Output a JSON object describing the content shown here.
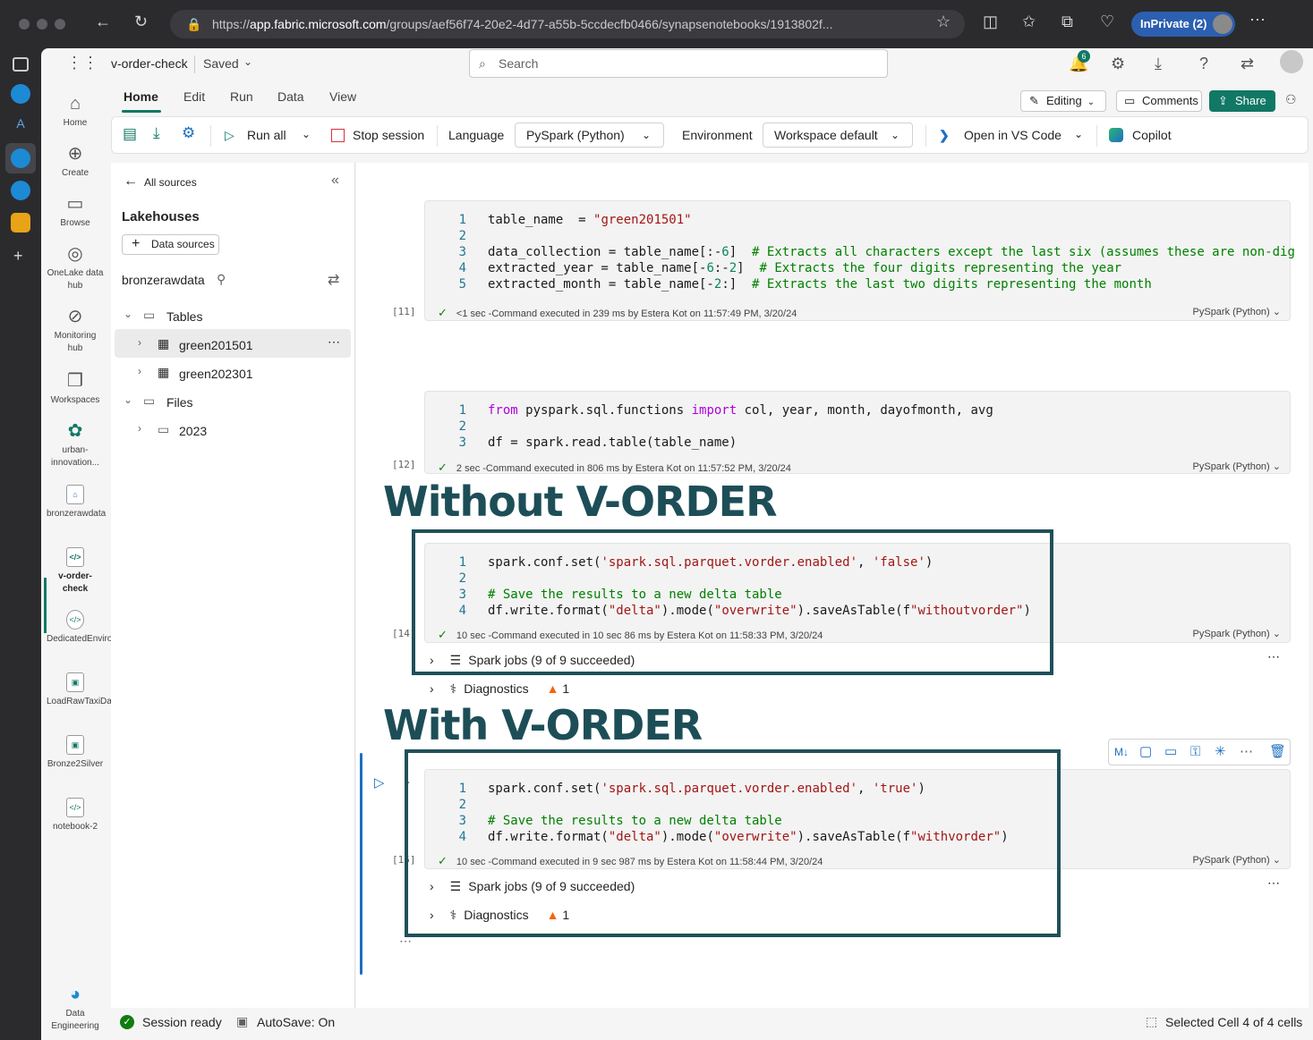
{
  "browser": {
    "url_prefix": "https://",
    "url_domain": "app.fabric.microsoft.com",
    "url_rest": "/groups/aef56f74-20e2-4d77-a55b-5ccdecfb0466/synapsenotebooks/1913802f...",
    "inprivate_label": "InPrivate (2)"
  },
  "header": {
    "notebook_name": "v-order-check",
    "save_state": "Saved",
    "search_placeholder": "Search",
    "notification_count": "6"
  },
  "leftnav": [
    {
      "label": "Home",
      "icon": "home-icon"
    },
    {
      "label": "Create",
      "icon": "create-icon"
    },
    {
      "label": "Browse",
      "icon": "browse-icon"
    },
    {
      "label": "OneLake data hub",
      "icon": "onelake-icon"
    },
    {
      "label": "Monitoring hub",
      "icon": "monitoring-icon"
    },
    {
      "label": "Workspaces",
      "icon": "workspaces-icon"
    },
    {
      "label": "urban-innovation...",
      "icon": "workspace-icon"
    },
    {
      "label": "bronzerawdata",
      "icon": "lakehouse-icon"
    },
    {
      "label": "v-order-check",
      "icon": "notebook-icon"
    },
    {
      "label": "DedicatedEnvironment...",
      "icon": "notebook-icon"
    },
    {
      "label": "LoadRawTaxiData",
      "icon": "pipeline-icon"
    },
    {
      "label": "Bronze2Silver",
      "icon": "pipeline-icon"
    },
    {
      "label": "notebook-2",
      "icon": "notebook-icon"
    },
    {
      "label": "Data Engineering",
      "icon": "fabric-icon"
    }
  ],
  "ribbon": {
    "tabs": [
      "Home",
      "Edit",
      "Run",
      "Data",
      "View"
    ],
    "editing": "Editing",
    "comments": "Comments",
    "share": "Share",
    "run_all": "Run all",
    "stop_session": "Stop session",
    "language_label": "Language",
    "language_value": "PySpark (Python)",
    "environment_label": "Environment",
    "environment_value": "Workspace default",
    "open_vscode": "Open in VS Code",
    "copilot": "Copilot"
  },
  "explorer": {
    "back": "All sources",
    "section_title": "Lakehouses",
    "data_sources": "Data sources",
    "lakehouse_name": "bronzerawdata",
    "tables_label": "Tables",
    "tables": [
      "green201501",
      "green202301"
    ],
    "files_label": "Files",
    "files": [
      "2023"
    ]
  },
  "cells": [
    {
      "exec_count": "[11]",
      "status": "<1 sec -Command executed in 239 ms by Estera Kot on 11:57:49 PM, 3/20/24",
      "lang": "PySpark (Python)"
    },
    {
      "exec_count": "[12]",
      "status": "2 sec -Command executed in 806 ms by Estera Kot on 11:57:52 PM, 3/20/24",
      "lang": "PySpark (Python)"
    },
    {
      "exec_count": "[14]",
      "status": "10 sec -Command executed in 10 sec 86 ms by Estera Kot on 11:58:33 PM, 3/20/24",
      "lang": "PySpark (Python)",
      "spark_jobs": "Spark jobs (9 of 9 succeeded)",
      "diagnostics": "Diagnostics",
      "warnings": "1"
    },
    {
      "exec_count": "[15]",
      "status": "10 sec -Command executed in 9 sec 987 ms by Estera Kot on 11:58:44 PM, 3/20/24",
      "lang": "PySpark (Python)",
      "spark_jobs": "Spark jobs (9 of 9 succeeded)",
      "diagnostics": "Diagnostics",
      "warnings": "1"
    }
  ],
  "annotations": {
    "without": "Without V-ORDER",
    "with": "With V-ORDER"
  },
  "statusbar": {
    "session": "Session ready",
    "autosave": "AutoSave: On",
    "selection": "Selected Cell 4 of 4 cells"
  },
  "colors": {
    "accent": "#117865",
    "annotation": "#1d4e57",
    "success": "#107c10",
    "warning": "#f7630c"
  }
}
